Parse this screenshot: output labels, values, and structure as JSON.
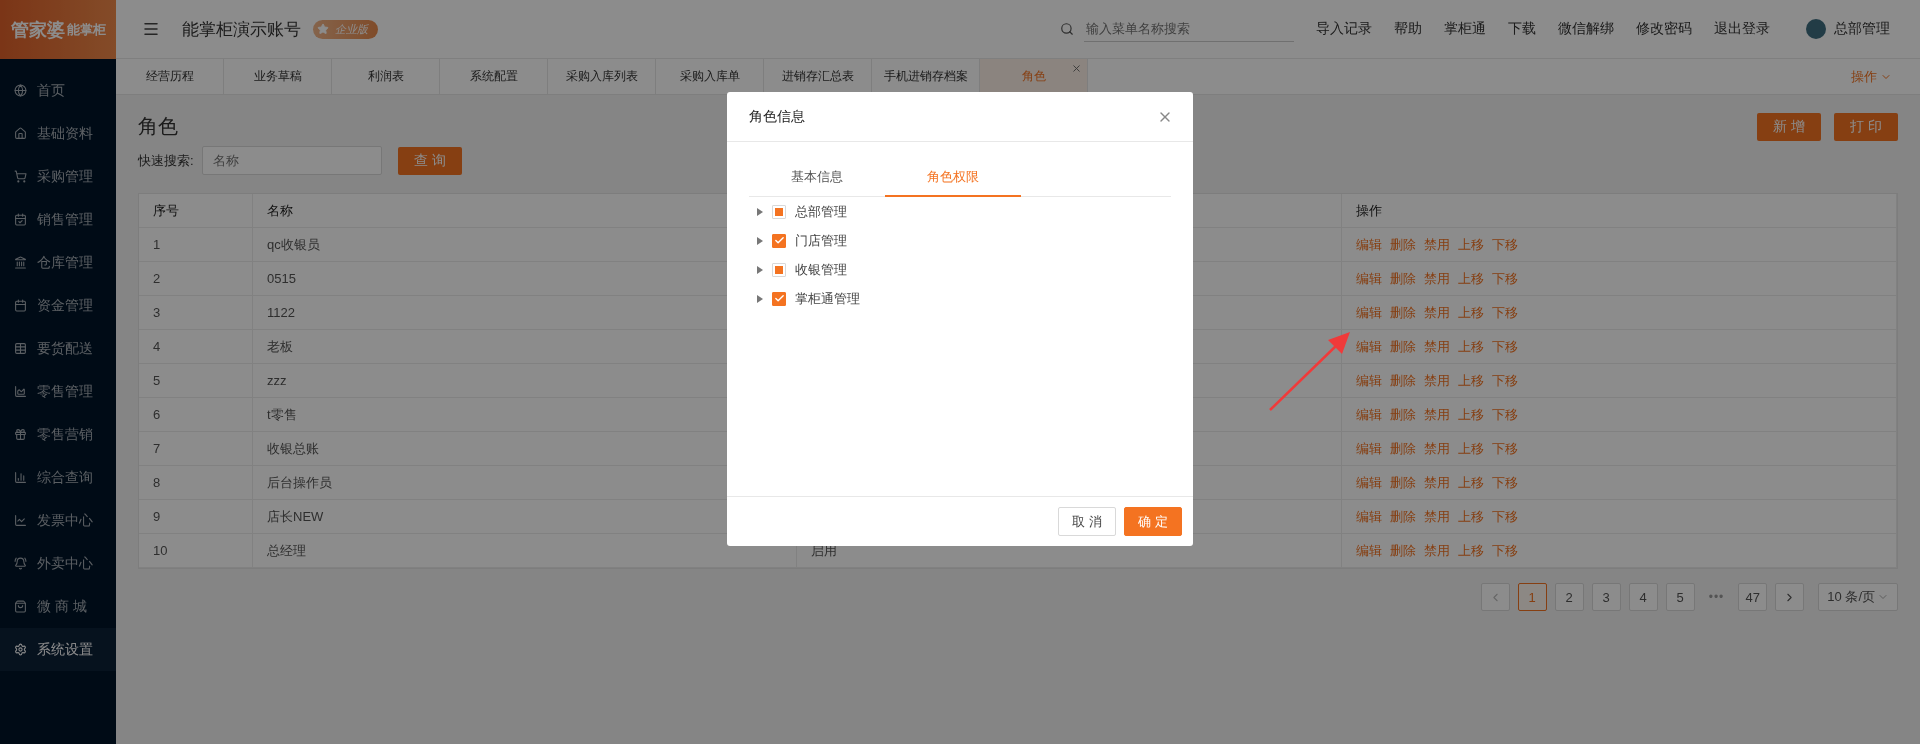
{
  "logo": {
    "brand": "管家婆",
    "product": "能掌柜"
  },
  "header": {
    "title": "能掌柜演示账号",
    "badge": "企业版",
    "search": {
      "placeholder": "输入菜单名称搜索"
    },
    "links": [
      "导入记录",
      "帮助",
      "掌柜通",
      "下载",
      "微信解绑",
      "修改密码",
      "退出登录"
    ],
    "user": "总部管理"
  },
  "sidebar": {
    "items": [
      {
        "label": "首页",
        "selected": false
      },
      {
        "label": "基础资料",
        "selected": false
      },
      {
        "label": "采购管理",
        "selected": false
      },
      {
        "label": "销售管理",
        "selected": false
      },
      {
        "label": "仓库管理",
        "selected": false
      },
      {
        "label": "资金管理",
        "selected": false
      },
      {
        "label": "要货配送",
        "selected": false
      },
      {
        "label": "零售管理",
        "selected": false
      },
      {
        "label": "零售营销",
        "selected": false
      },
      {
        "label": "综合查询",
        "selected": false
      },
      {
        "label": "发票中心",
        "selected": false
      },
      {
        "label": "外卖中心",
        "selected": false
      },
      {
        "label": "微 商 城",
        "selected": false
      },
      {
        "label": "系统设置",
        "selected": true
      }
    ]
  },
  "tabs": [
    {
      "label": "经营历程",
      "selected": false
    },
    {
      "label": "业务草稿",
      "selected": false
    },
    {
      "label": "利润表",
      "selected": false
    },
    {
      "label": "系统配置",
      "selected": false
    },
    {
      "label": "采购入库列表",
      "selected": false
    },
    {
      "label": "采购入库单",
      "selected": false
    },
    {
      "label": "进销存汇总表",
      "selected": false
    },
    {
      "label": "手机进销存档案",
      "selected": false
    },
    {
      "label": "角色",
      "selected": true
    }
  ],
  "tab_actions": "操作",
  "page": {
    "title": "角色",
    "search_label": "快速搜索:",
    "search": {
      "placeholder": "名称"
    },
    "query_button": "查 询",
    "buttons": [
      "新 增",
      "打 印"
    ]
  },
  "table": {
    "columns": {
      "column_1": "序号",
      "column_2": "名称",
      "column_4": "操作"
    },
    "rows": [
      {
        "index": "1",
        "name": "qc收银员",
        "actions": [
          "编辑",
          "删除",
          "禁用",
          "上移",
          "下移"
        ]
      },
      {
        "index": "2",
        "name": "0515",
        "actions": [
          "编辑",
          "删除",
          "禁用",
          "上移",
          "下移"
        ]
      },
      {
        "index": "3",
        "name": "1122",
        "actions": [
          "编辑",
          "删除",
          "禁用",
          "上移",
          "下移"
        ]
      },
      {
        "index": "4",
        "name": "老板",
        "actions": [
          "编辑",
          "删除",
          "禁用",
          "上移",
          "下移"
        ]
      },
      {
        "index": "5",
        "name": "zzz",
        "actions": [
          "编辑",
          "删除",
          "禁用",
          "上移",
          "下移"
        ]
      },
      {
        "index": "6",
        "name": "t零售",
        "actions": [
          "编辑",
          "删除",
          "禁用",
          "上移",
          "下移"
        ]
      },
      {
        "index": "7",
        "name": "收银总账",
        "actions": [
          "编辑",
          "删除",
          "禁用",
          "上移",
          "下移"
        ]
      },
      {
        "index": "8",
        "name": "后台操作员",
        "actions": [
          "编辑",
          "删除",
          "禁用",
          "上移",
          "下移"
        ]
      },
      {
        "index": "9",
        "name": "店长NEW",
        "actions": [
          "编辑",
          "删除",
          "禁用",
          "上移",
          "下移"
        ]
      },
      {
        "index": "10",
        "name": "总经理",
        "status": "启用",
        "actions": [
          "编辑",
          "删除",
          "禁用",
          "上移",
          "下移"
        ]
      }
    ]
  },
  "pagination": {
    "pages": [
      {
        "label": "1",
        "selected": true
      },
      {
        "label": "2",
        "selected": false
      },
      {
        "label": "3",
        "selected": false
      },
      {
        "label": "4",
        "selected": false
      },
      {
        "label": "5",
        "selected": false
      },
      {
        "label": "•••",
        "kind": "ellipsis"
      },
      {
        "label": "47",
        "selected": false
      }
    ],
    "per_page": "10 条/页"
  },
  "dialog": {
    "title": "角色信息",
    "tabs": [
      {
        "label": "基本信息",
        "selected": false
      },
      {
        "label": "角色权限",
        "selected": true
      }
    ],
    "tree": [
      {
        "label": "总部管理",
        "checked": false,
        "indeterminate": true,
        "expanded": false
      },
      {
        "label": "门店管理",
        "checked": true,
        "indeterminate": false,
        "expanded": false
      },
      {
        "label": "收银管理",
        "checked": false,
        "indeterminate": true,
        "expanded": false
      },
      {
        "label": "掌柜通管理",
        "checked": true,
        "indeterminate": false,
        "expanded": false
      }
    ],
    "buttons": [
      {
        "label": "取 消",
        "kind": "default"
      },
      {
        "label": "确 定",
        "kind": "primary"
      }
    ]
  }
}
